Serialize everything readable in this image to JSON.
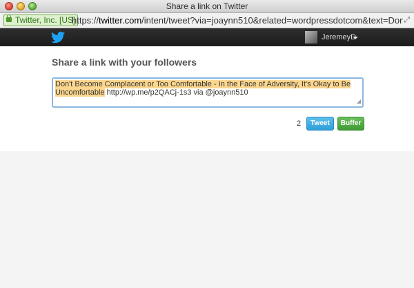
{
  "window": {
    "title": "Share a link on Twitter"
  },
  "urlbar": {
    "ssl_label": "Twitter, Inc. [US]",
    "url_prefix": "https://",
    "url_host": "twitter.com",
    "url_path": "/intent/tweet?via=joaynn510&related=wordpressdotcom&text=Don%27t+Beco..."
  },
  "header": {
    "username": "JeremeyD"
  },
  "main": {
    "heading": "Share a link with your followers",
    "tweet_highlight": "Don't Become Complacent or Too Comfortable - In the Face of Adversity, It's Okay to Be Uncomfortable",
    "tweet_rest": " http://wp.me/p2QACj-1s3 via @joaynn510",
    "char_count": "2",
    "tweet_button": "Tweet",
    "buffer_button": "Buffer"
  },
  "colors": {
    "twitter_blue": "#2f9fd8",
    "buffer_green": "#3f9a35",
    "highlight": "#fbd68e"
  }
}
